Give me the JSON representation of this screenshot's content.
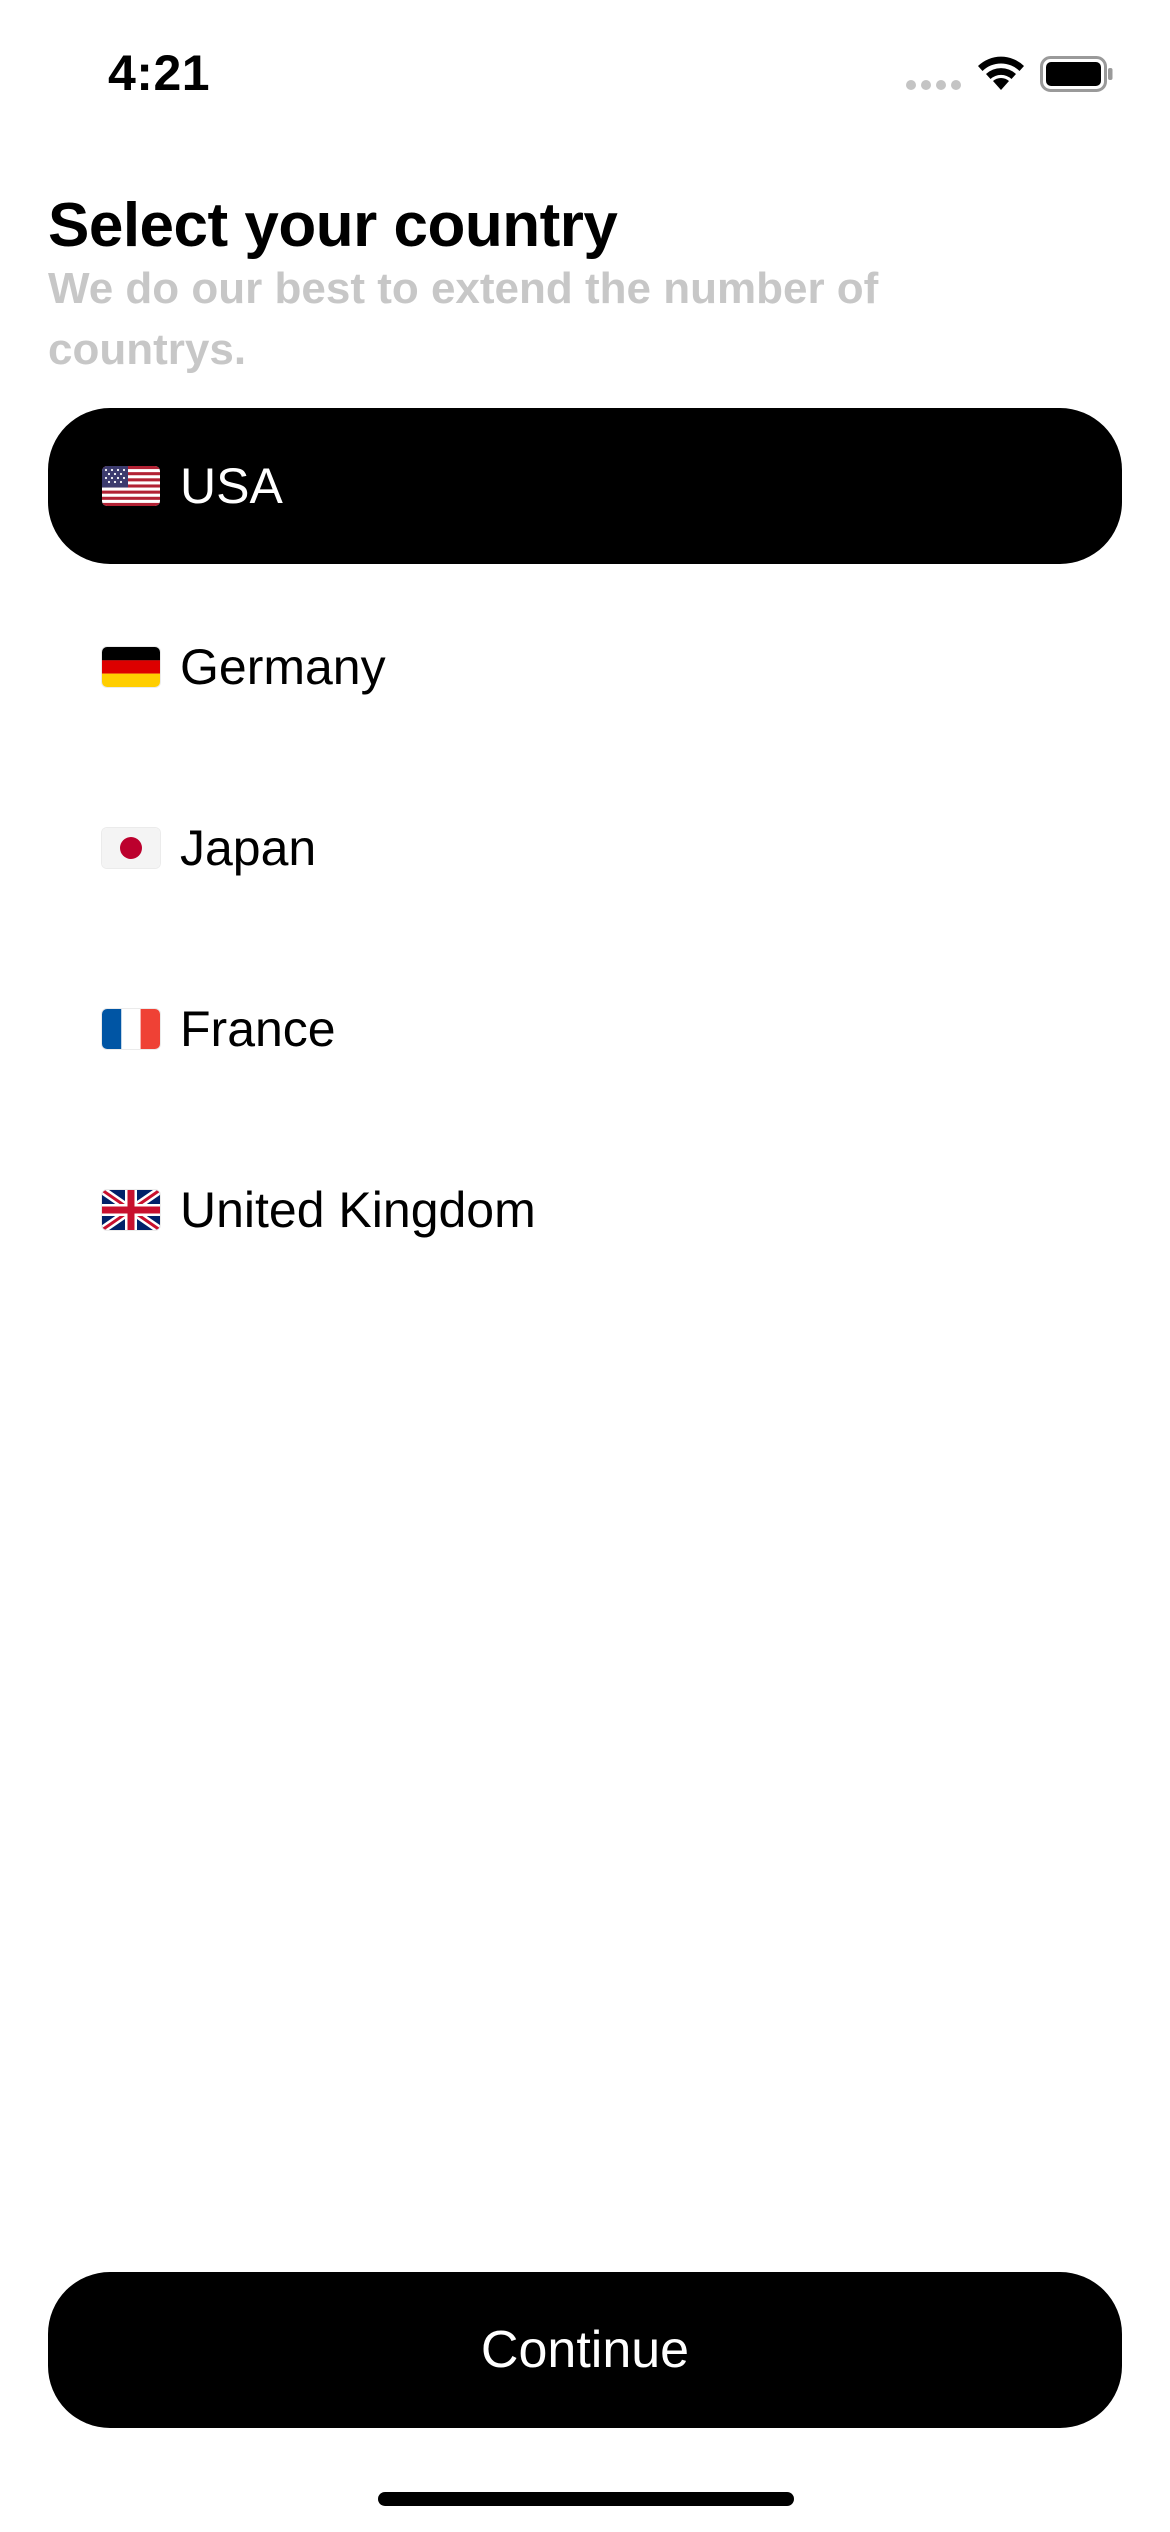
{
  "status_bar": {
    "time": "4:21",
    "icons": [
      "cellular-signal-icon",
      "wifi-icon",
      "battery-icon"
    ]
  },
  "header": {
    "title": "Select your country",
    "subtitle": "We do our best to extend the number of countrys."
  },
  "countries": [
    {
      "name": "USA",
      "flag": "us-flag-icon",
      "selected": true
    },
    {
      "name": "Germany",
      "flag": "de-flag-icon",
      "selected": false
    },
    {
      "name": "Japan",
      "flag": "jp-flag-icon",
      "selected": false
    },
    {
      "name": "France",
      "flag": "fr-flag-icon",
      "selected": false
    },
    {
      "name": "United Kingdom",
      "flag": "gb-flag-icon",
      "selected": false
    }
  ],
  "continue_button": {
    "label": "Continue"
  },
  "colors": {
    "selected_background": "#000000",
    "selected_text": "#ffffff",
    "subtitle_text": "#c7c7c7",
    "button_background": "#000000"
  }
}
